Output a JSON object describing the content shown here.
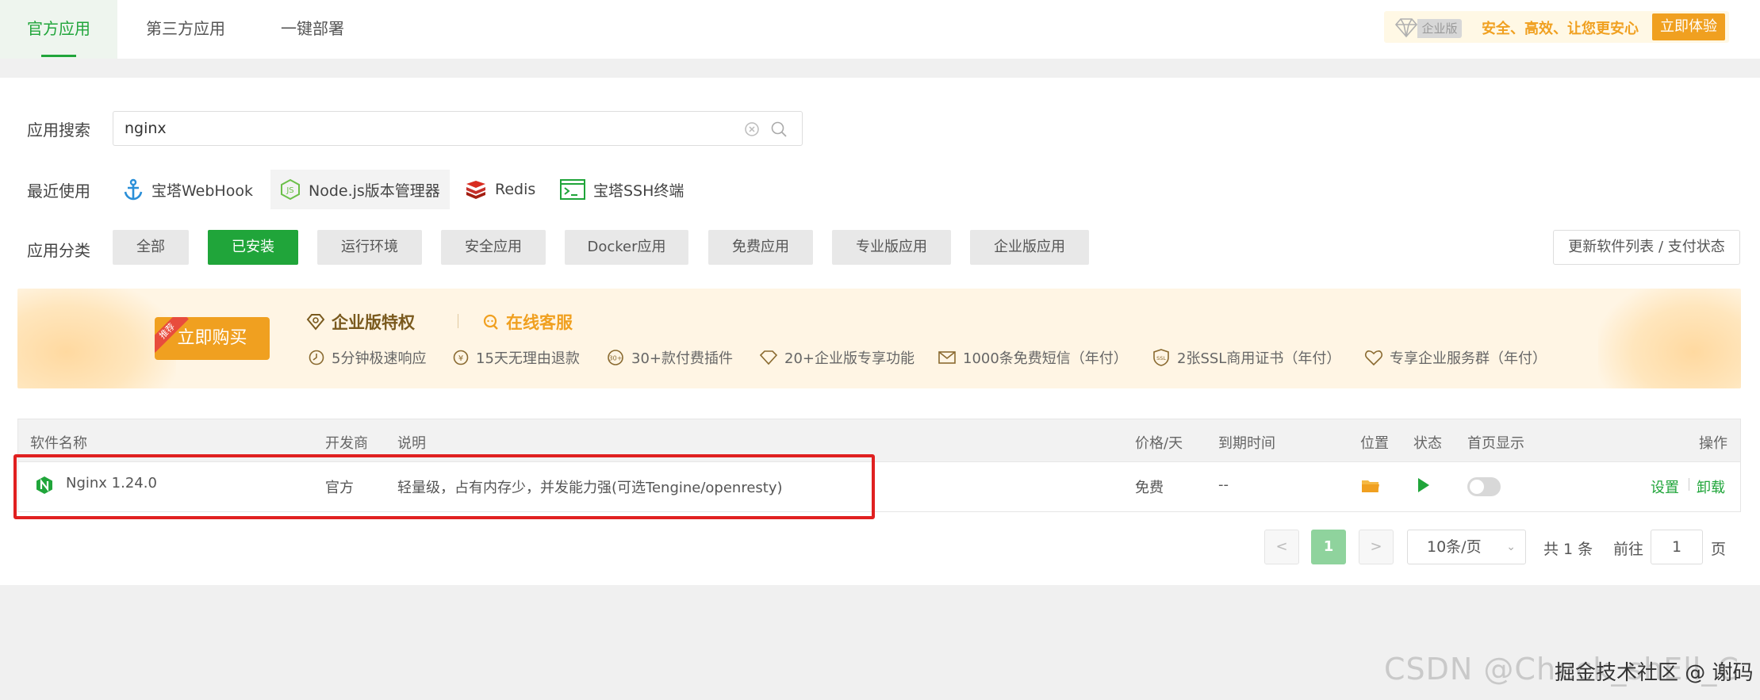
{
  "tabs": [
    {
      "label": "官方应用",
      "active": true
    },
    {
      "label": "第三方应用",
      "active": false
    },
    {
      "label": "一键部署",
      "active": false
    }
  ],
  "promo": {
    "tag": "企业版",
    "slogan": "安全、高效、让您更安心",
    "button": "立即体验"
  },
  "search": {
    "label": "应用搜索",
    "value": "nginx"
  },
  "recent": {
    "label": "最近使用",
    "items": [
      "宝塔WebHook",
      "Node.js版本管理器",
      "Redis",
      "宝塔SSH终端"
    ]
  },
  "categories": {
    "label": "应用分类",
    "items": [
      "全部",
      "已安装",
      "运行环境",
      "安全应用",
      "Docker应用",
      "免费应用",
      "专业版应用",
      "企业版应用"
    ],
    "active": "已安装",
    "refresh_button": "更新软件列表 / 支付状态"
  },
  "banner": {
    "buy_button": "立即购买",
    "buy_badge": "推荐",
    "title1": "企业版特权",
    "title2": "在线客服",
    "features": [
      "5分钟极速响应",
      "15天无理由退款",
      "30+款付费插件",
      "20+企业版专享功能",
      "1000条免费短信（年付）",
      "2张SSL商用证书（年付）",
      "专享企业服务群（年付）"
    ]
  },
  "table": {
    "headers": {
      "name": "软件名称",
      "developer": "开发商",
      "description": "说明",
      "price": "价格/天",
      "expire": "到期时间",
      "location": "位置",
      "status": "状态",
      "homepage": "首页显示",
      "actions": "操作"
    },
    "rows": [
      {
        "name": "Nginx 1.24.0",
        "developer": "官方",
        "description": "轻量级，占有内存少，并发能力强(可选Tengine/openresty)",
        "price": "免费",
        "expire": "--",
        "homepage_enabled": false,
        "settings": "设置",
        "uninstall": "卸载"
      }
    ]
  },
  "pagination": {
    "prev": "<",
    "current": "1",
    "next": ">",
    "page_size": "10条/页",
    "total": "共 1 条",
    "goto_label": "前往",
    "goto_value": "1",
    "page_suffix": "页"
  },
  "watermark": {
    "csdn": "CSDN @Check_shEll_C",
    "juejin": "掘金技术社区 @ 谢码"
  },
  "colors": {
    "accent": "#20a53a",
    "orange": "#f0a020",
    "highlight_box": "#e02020"
  }
}
